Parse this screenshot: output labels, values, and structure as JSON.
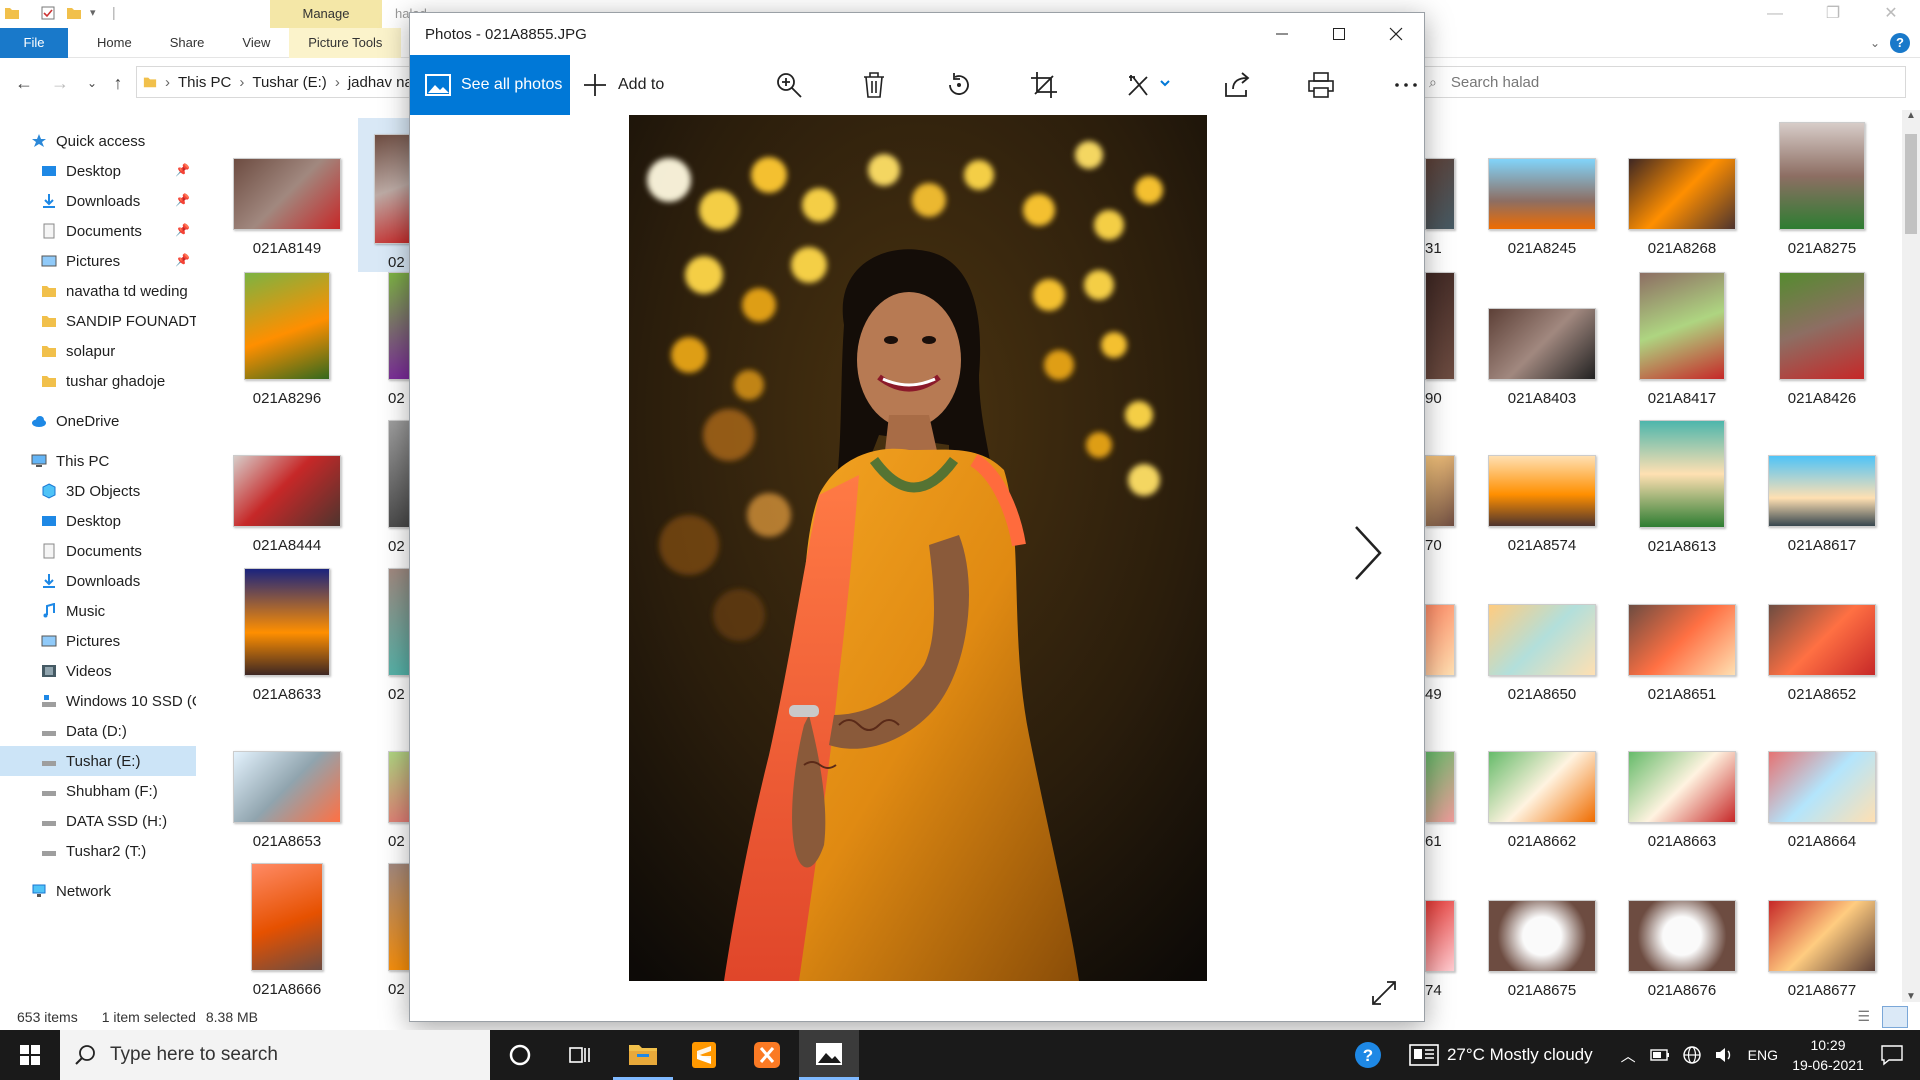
{
  "explorer": {
    "title_ghost": "halad",
    "manage_tab": "Manage",
    "ribbon_tabs": [
      "File",
      "Home",
      "Share",
      "View",
      "Picture Tools"
    ],
    "breadcrumb": [
      "This PC",
      "Tushar (E:)",
      "jadhav na"
    ],
    "search_placeholder": "Search halad",
    "status_count": "653 items",
    "status_selected": "1 item selected",
    "status_size": "8.38 MB",
    "nav": {
      "quick_access": "Quick access",
      "quick_items": [
        "Desktop",
        "Downloads",
        "Documents",
        "Pictures",
        "navatha td weding",
        "SANDIP FOUNADTI(",
        "solapur",
        "tushar ghadoje"
      ],
      "onedrive": "OneDrive",
      "this_pc": "This PC",
      "pc_items": [
        "3D Objects",
        "Desktop",
        "Documents",
        "Downloads",
        "Music",
        "Pictures",
        "Videos",
        "Windows 10 SSD (C",
        "Data (D:)",
        "Tushar (E:)",
        "Shubham (F:)",
        "DATA SSD (H:)",
        "Tushar2 (T:)"
      ],
      "network": "Network"
    },
    "left_col1": [
      "021A8149",
      "021A8296",
      "021A8444",
      "021A8633",
      "021A8653",
      "021A8666"
    ],
    "left_col2": [
      "02",
      "02",
      "02",
      "02",
      "02",
      "02"
    ],
    "partial_col": [
      "31",
      "90",
      "70",
      "49",
      "61",
      "74"
    ],
    "right_cols": [
      [
        "021A8245",
        "021A8403",
        "021A8574",
        "021A8650",
        "021A8662",
        "021A8675"
      ],
      [
        "021A8268",
        "021A8417",
        "021A8613",
        "021A8651",
        "021A8663",
        "021A8676"
      ],
      [
        "021A8275",
        "021A8426",
        "021A8617",
        "021A8652",
        "021A8664",
        "021A8677"
      ]
    ]
  },
  "photos": {
    "title": "Photos - 021A8855.JPG",
    "see_all": "See all photos",
    "add_to": "Add to",
    "toolbar_icons": [
      "zoom-icon",
      "delete-icon",
      "rotate-icon",
      "crop-icon",
      "edit-icon",
      "share-icon",
      "print-icon",
      "more-icon"
    ]
  },
  "taskbar": {
    "search_placeholder": "Type here to search",
    "weather": "27°C  Mostly cloudy",
    "language": "ENG",
    "time": "10:29",
    "date": "19-06-2021"
  },
  "colors": {
    "accent": "#0078d7",
    "file_tab": "#1979ca",
    "manage": "#f4e7a7",
    "taskbar": "#1a1a1a"
  }
}
